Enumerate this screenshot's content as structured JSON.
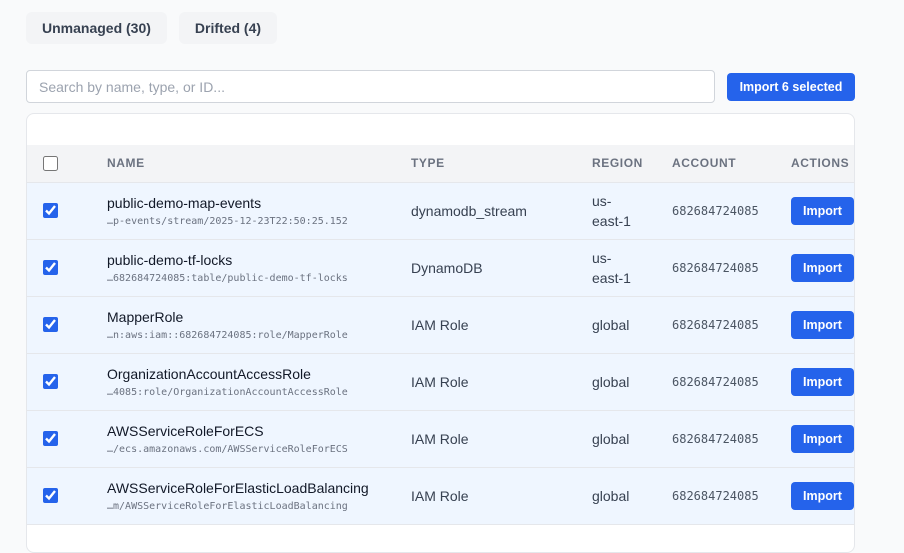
{
  "tabs": [
    {
      "label": "Unmanaged (30)"
    },
    {
      "label": "Drifted (4)"
    }
  ],
  "search": {
    "placeholder": "Search by name, type, or ID..."
  },
  "toolbar": {
    "import_selected_label": "Import 6 selected"
  },
  "table": {
    "headers": [
      "NAME",
      "TYPE",
      "REGION",
      "ACCOUNT",
      "ACTIONS"
    ],
    "rows": [
      {
        "name": "public-demo-map-events",
        "id": "…p-events/stream/2025-12-23T22:50:25.152",
        "type": "dynamodb_stream",
        "region_line1": "us-",
        "region_line2": "east-1",
        "account": "682684724085",
        "action": "Import",
        "checked": true
      },
      {
        "name": "public-demo-tf-locks",
        "id": "…682684724085:table/public-demo-tf-locks",
        "type": "DynamoDB",
        "region_line1": "us-",
        "region_line2": "east-1",
        "account": "682684724085",
        "action": "Import",
        "checked": true
      },
      {
        "name": "MapperRole",
        "id": "…n:aws:iam::682684724085:role/MapperRole",
        "type": "IAM Role",
        "region_line1": "global",
        "region_line2": "",
        "account": "682684724085",
        "action": "Import",
        "checked": true
      },
      {
        "name": "OrganizationAccountAccessRole",
        "id": "…4085:role/OrganizationAccountAccessRole",
        "type": "IAM Role",
        "region_line1": "global",
        "region_line2": "",
        "account": "682684724085",
        "action": "Import",
        "checked": true
      },
      {
        "name": "AWSServiceRoleForECS",
        "id": "…/ecs.amazonaws.com/AWSServiceRoleForECS",
        "type": "IAM Role",
        "region_line1": "global",
        "region_line2": "",
        "account": "682684724085",
        "action": "Import",
        "checked": true
      },
      {
        "name": "AWSServiceRoleForElasticLoadBalancing",
        "id": "…m/AWSServiceRoleForElasticLoadBalancing",
        "type": "IAM Role",
        "region_line1": "global",
        "region_line2": "",
        "account": "682684724085",
        "action": "Import",
        "checked": true
      }
    ]
  }
}
